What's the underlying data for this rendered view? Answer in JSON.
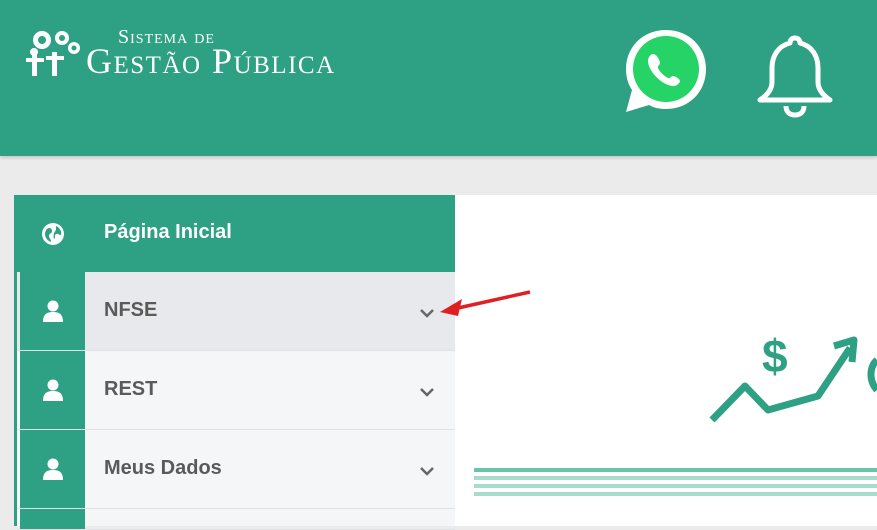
{
  "header": {
    "logo_line1": "Sistema de",
    "logo_line2": "Gestão Pública",
    "whatsapp_icon": "whatsapp-icon",
    "bell_icon": "bell-icon"
  },
  "sidebar": {
    "items": [
      {
        "label": "Página Inicial",
        "icon": "globe-icon"
      },
      {
        "label": "NFSE",
        "icon": "user-icon"
      },
      {
        "label": "REST",
        "icon": "user-icon"
      },
      {
        "label": "Meus Dados",
        "icon": "user-icon"
      }
    ]
  },
  "colors": {
    "accent": "#2ea083",
    "annotation_arrow": "#e02020"
  }
}
